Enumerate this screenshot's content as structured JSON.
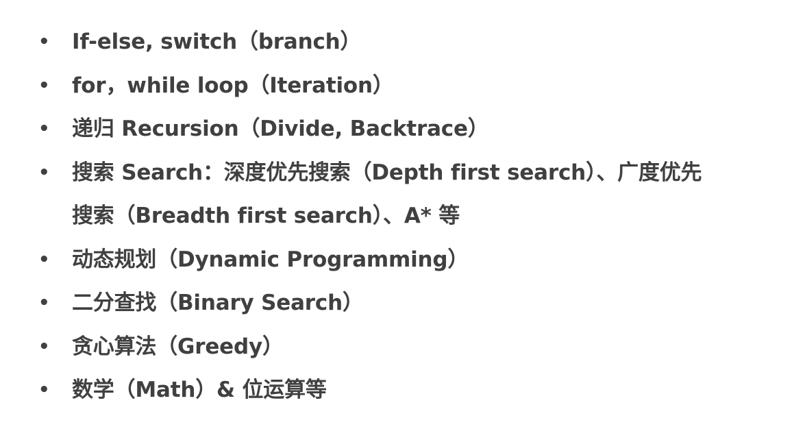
{
  "slide": {
    "bullet_symbol": "•",
    "items": [
      {
        "lines": [
          "If-else, switch（branch）"
        ]
      },
      {
        "lines": [
          "for，while loop（Iteration）"
        ]
      },
      {
        "lines": [
          "递归 Recursion（Divide, Backtrace）"
        ]
      },
      {
        "lines": [
          "搜索 Search：深度优先搜索（Depth first search）、广度优先",
          "搜索（Breadth first search）、A* 等"
        ]
      },
      {
        "lines": [
          "动态规划（Dynamic Programming）"
        ]
      },
      {
        "lines": [
          "二分查找（Binary Search）"
        ]
      },
      {
        "lines": [
          "贪心算法（Greedy）"
        ]
      },
      {
        "lines": [
          "数学（Math）& 位运算等"
        ]
      }
    ]
  }
}
